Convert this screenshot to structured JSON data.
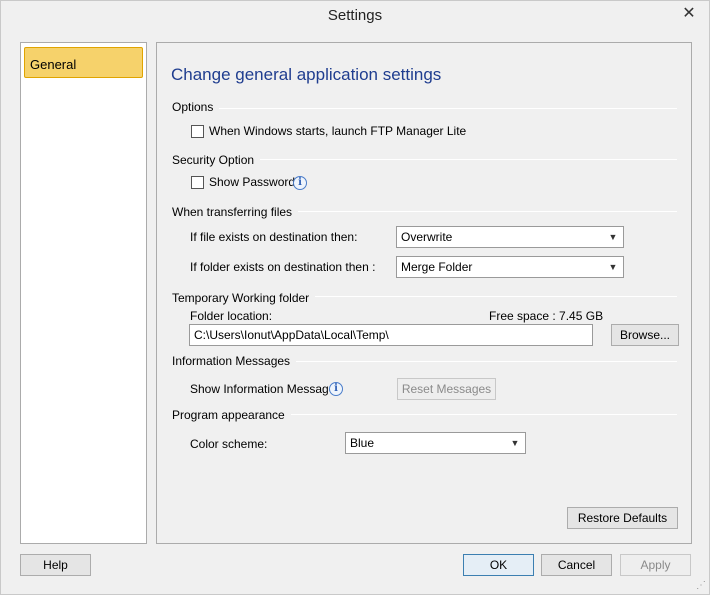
{
  "window": {
    "title": "Settings"
  },
  "sidebar": {
    "items": [
      {
        "label": "General"
      }
    ]
  },
  "main": {
    "heading": "Change general application settings",
    "sections": {
      "options": {
        "title": "Options",
        "launch_checkbox_label": "When Windows starts, launch FTP Manager Lite",
        "launch_checked": false
      },
      "security": {
        "title": "Security Option",
        "show_password_label": "Show Password",
        "show_password_checked": false
      },
      "transfer": {
        "title": "When transferring files",
        "file_exists_label": "If file exists on destination then:",
        "file_exists_value": "Overwrite",
        "folder_exists_label": "If folder exists on destination then :",
        "folder_exists_value": "Merge Folder"
      },
      "temp_folder": {
        "title": "Temporary Working folder",
        "folder_location_label": "Folder location:",
        "free_space_label": "Free space :",
        "free_space_value": "7.45 GB",
        "path_value": "C:\\Users\\Ionut\\AppData\\Local\\Temp\\",
        "browse_label": "Browse..."
      },
      "info_messages": {
        "title": "Information Messages",
        "show_label": "Show Information Messages",
        "reset_label": "Reset Messages"
      },
      "appearance": {
        "title": "Program appearance",
        "color_scheme_label": "Color scheme:",
        "color_scheme_value": "Blue"
      }
    },
    "restore_defaults_label": "Restore Defaults"
  },
  "footer": {
    "help_label": "Help",
    "ok_label": "OK",
    "cancel_label": "Cancel",
    "apply_label": "Apply"
  },
  "icons": {
    "close": "close-icon",
    "info": "info-icon",
    "dropdown": "chevron-down-icon"
  },
  "colors": {
    "accent_heading": "#1f3d8f",
    "selected_item": "#f6d26b"
  }
}
